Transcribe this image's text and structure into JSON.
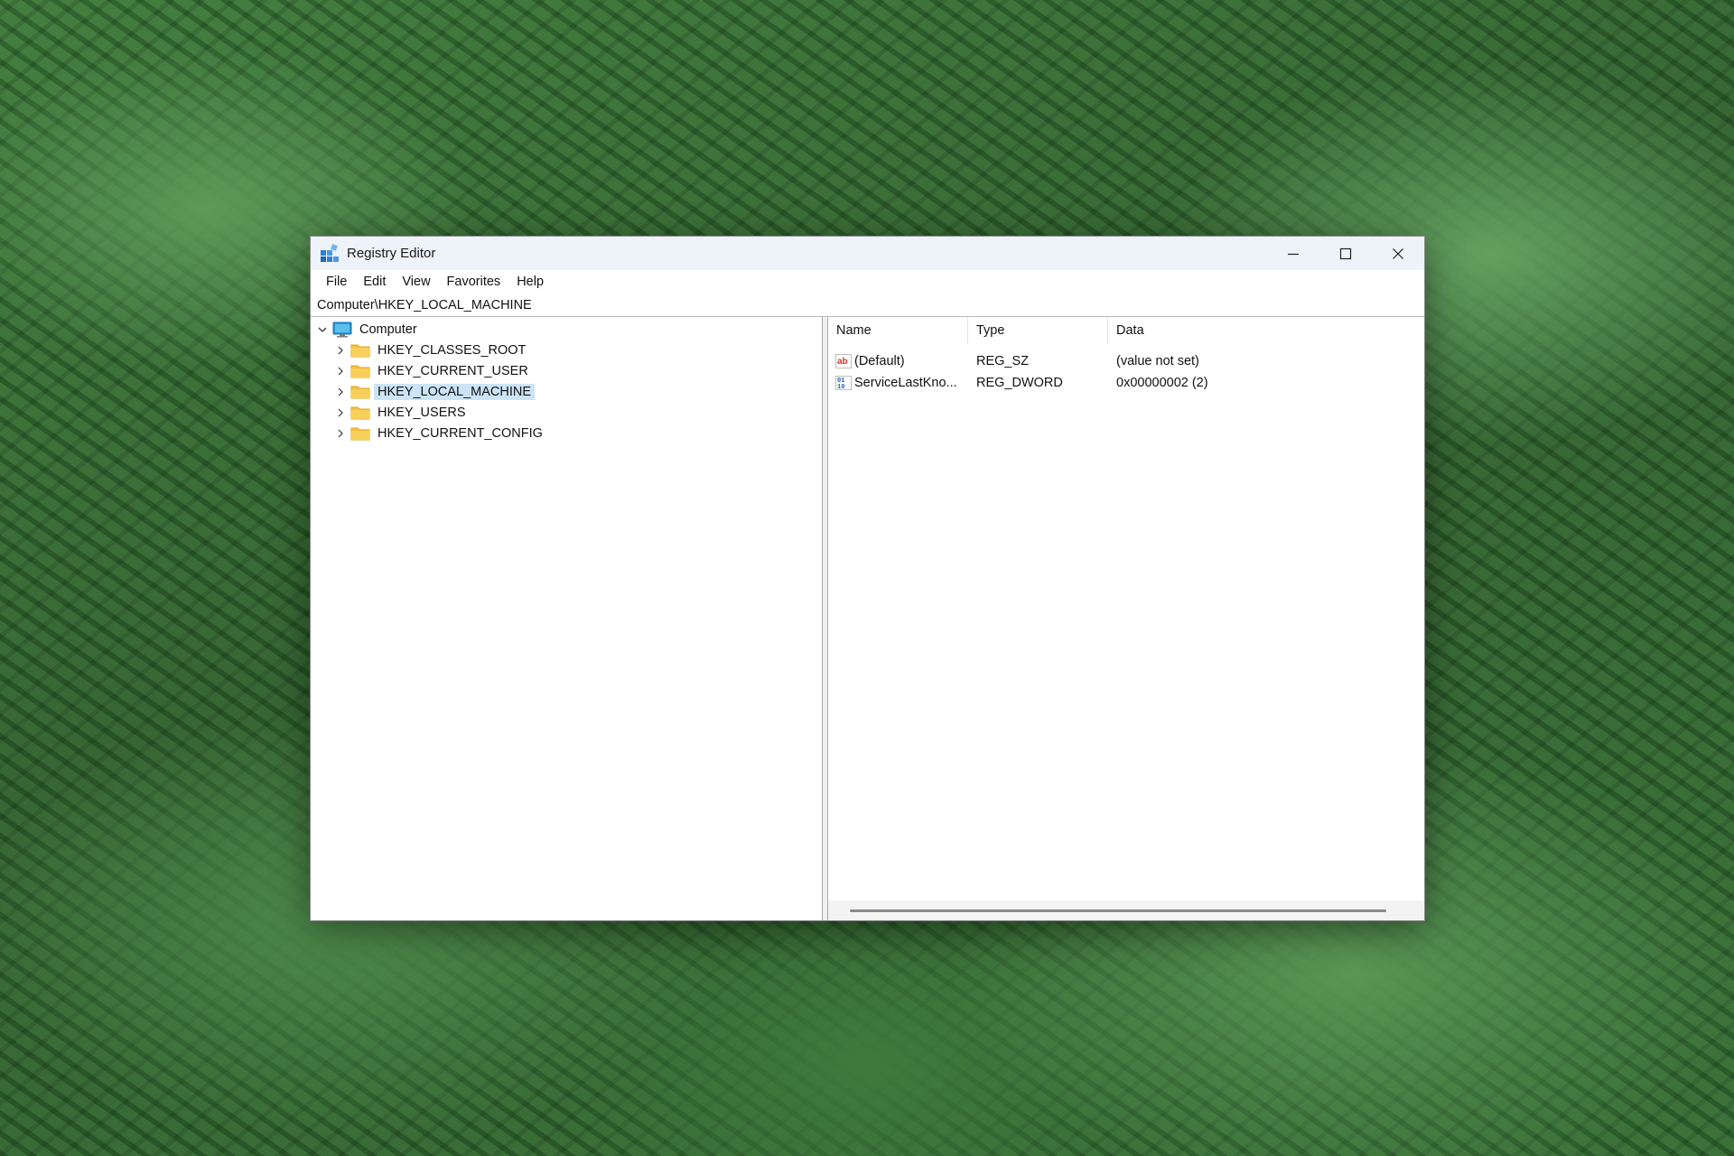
{
  "window": {
    "title": "Registry Editor",
    "controls": {
      "minimize": "minimize-icon",
      "maximize": "maximize-icon",
      "close": "close-icon"
    }
  },
  "menu": [
    "File",
    "Edit",
    "View",
    "Favorites",
    "Help"
  ],
  "address": "Computer\\HKEY_LOCAL_MACHINE",
  "tree": {
    "root": {
      "label": "Computer",
      "icon": "computer-icon",
      "expanded": true
    },
    "nodes": [
      {
        "label": "HKEY_CLASSES_ROOT",
        "icon": "folder-icon",
        "selected": false
      },
      {
        "label": "HKEY_CURRENT_USER",
        "icon": "folder-icon",
        "selected": false
      },
      {
        "label": "HKEY_LOCAL_MACHINE",
        "icon": "folder-icon",
        "selected": true
      },
      {
        "label": "HKEY_USERS",
        "icon": "folder-icon",
        "selected": false
      },
      {
        "label": "HKEY_CURRENT_CONFIG",
        "icon": "folder-icon",
        "selected": false
      }
    ]
  },
  "values": {
    "columns": [
      "Name",
      "Type",
      "Data"
    ],
    "rows": [
      {
        "name": "(Default)",
        "type": "REG_SZ",
        "data": "(value not set)",
        "icon": "string-value-icon"
      },
      {
        "name": "ServiceLastKno...",
        "type": "REG_DWORD",
        "data": "0x00000002 (2)",
        "icon": "binary-value-icon"
      }
    ]
  },
  "colors": {
    "selection": "#cce4f7",
    "folder": "#f5c242",
    "titlebar": "#eef2f9"
  }
}
